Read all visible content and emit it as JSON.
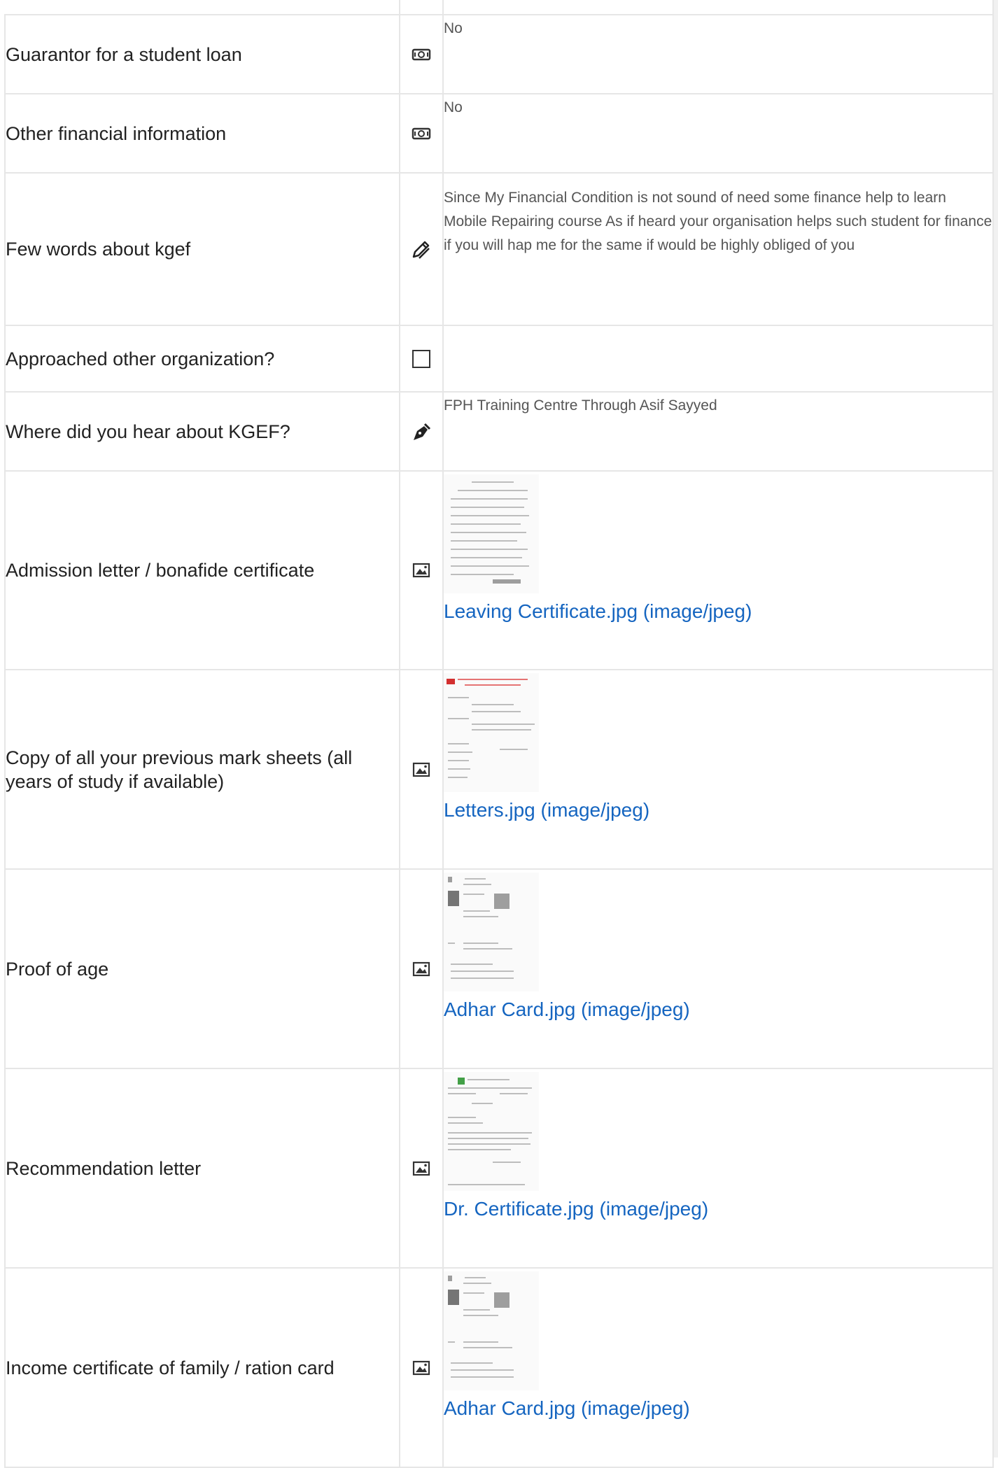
{
  "rows": [
    {
      "label": "Guarantor for a student loan",
      "icon": "money-icon",
      "value": "No"
    },
    {
      "label": "Other financial information",
      "icon": "money-icon",
      "value": "No"
    },
    {
      "label": "Few words about kgef",
      "icon": "pen-icon",
      "value": "Since My Financial Condition is not sound of need some finance help to learn Mobile Repairing course As if heard your organisation helps such student for finance if you will hap me for the same if would be highly obliged of you"
    },
    {
      "label": "Approached other organization?",
      "icon": "checkbox-icon"
    },
    {
      "label": "Where did you hear about KGEF?",
      "icon": "fountain-pen-icon",
      "value": "FPH Training Centre Through Asif Sayyed"
    },
    {
      "label": "Admission letter / bonafide certificate",
      "icon": "image-icon",
      "file": "Leaving Certificate.jpg (image/jpeg)"
    },
    {
      "label": "Copy of all your previous mark sheets (all years of study if available)",
      "icon": "image-icon",
      "file": "Letters.jpg (image/jpeg)"
    },
    {
      "label": "Proof of age",
      "icon": "image-icon",
      "file": "Adhar Card.jpg (image/jpeg)"
    },
    {
      "label": "Recommendation letter",
      "icon": "image-icon",
      "file": "Dr. Certificate.jpg (image/jpeg)"
    },
    {
      "label": "Income certificate of family / ration card",
      "icon": "image-icon",
      "file": "Adhar Card.jpg (image/jpeg)"
    }
  ],
  "colors": {
    "link": "#1565c0",
    "border": "#e6e6e6",
    "label": "#222222",
    "value": "#555555"
  }
}
